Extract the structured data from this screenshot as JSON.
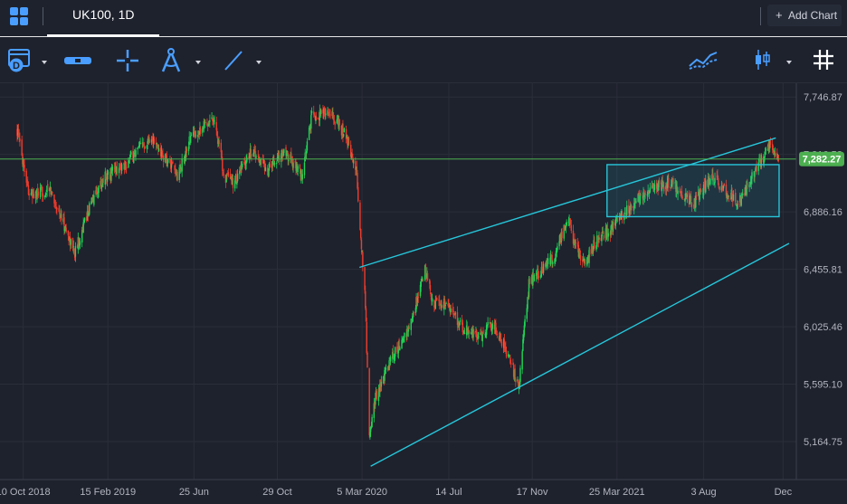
{
  "header": {
    "tab_title": "UK100, 1D",
    "add_chart_label": "Add Chart",
    "icons": [
      "layout-grid-icon",
      "date-range-icon",
      "measure-icon",
      "crosshair-icon",
      "drawing-compass-icon",
      "trend-line-icon",
      "indicators-icon",
      "candle-style-icon",
      "grid-toggle-icon"
    ]
  },
  "chart_data": {
    "type": "candlestick",
    "symbol": "UK100",
    "interval": "1D",
    "x_tick_labels": [
      "10 Oct 2018",
      "15 Feb 2019",
      "25 Jun",
      "29 Oct",
      "5 Mar 2020",
      "14 Jul",
      "17 Nov",
      "25 Mar 2021",
      "3 Aug",
      "Dec"
    ],
    "y_tick_labels": [
      "7,746.87",
      "7,316.52",
      "6,886.16",
      "6,455.81",
      "6,025.46",
      "5,595.10",
      "5,164.75"
    ],
    "ylim": [
      4880,
      7850
    ],
    "current_price": 7282.27,
    "current_price_label": "7,282.27",
    "price_path": [
      [
        "2018-10-01",
        7500
      ],
      [
        "2018-10-20",
        7000
      ],
      [
        "2018-11-20",
        7050
      ],
      [
        "2018-12-27",
        6580
      ],
      [
        "2019-01-20",
        6950
      ],
      [
        "2019-02-10",
        7150
      ],
      [
        "2019-03-15",
        7250
      ],
      [
        "2019-04-20",
        7450
      ],
      [
        "2019-05-10",
        7300
      ],
      [
        "2019-06-01",
        7150
      ],
      [
        "2019-06-20",
        7450
      ],
      [
        "2019-07-25",
        7600
      ],
      [
        "2019-08-10",
        7150
      ],
      [
        "2019-08-25",
        7100
      ],
      [
        "2019-09-20",
        7350
      ],
      [
        "2019-10-15",
        7200
      ],
      [
        "2019-11-10",
        7350
      ],
      [
        "2019-12-05",
        7150
      ],
      [
        "2019-12-20",
        7600
      ],
      [
        "2020-01-15",
        7640
      ],
      [
        "2020-02-10",
        7450
      ],
      [
        "2020-02-25",
        7200
      ],
      [
        "2020-03-10",
        6200
      ],
      [
        "2020-03-16",
        5200
      ],
      [
        "2020-03-25",
        5500
      ],
      [
        "2020-04-20",
        5800
      ],
      [
        "2020-05-15",
        6000
      ],
      [
        "2020-06-08",
        6450
      ],
      [
        "2020-06-20",
        6200
      ],
      [
        "2020-07-10",
        6200
      ],
      [
        "2020-08-05",
        6000
      ],
      [
        "2020-09-01",
        5950
      ],
      [
        "2020-09-15",
        6050
      ],
      [
        "2020-10-05",
        5900
      ],
      [
        "2020-10-28",
        5580
      ],
      [
        "2020-11-12",
        6350
      ],
      [
        "2020-12-01",
        6450
      ],
      [
        "2020-12-20",
        6550
      ],
      [
        "2021-01-10",
        6850
      ],
      [
        "2021-01-20",
        6650
      ],
      [
        "2021-02-05",
        6500
      ],
      [
        "2021-02-25",
        6700
      ],
      [
        "2021-03-15",
        6750
      ],
      [
        "2021-04-10",
        6900
      ],
      [
        "2021-05-10",
        7050
      ],
      [
        "2021-06-15",
        7100
      ],
      [
        "2021-07-20",
        6950
      ],
      [
        "2021-08-15",
        7150
      ],
      [
        "2021-09-05",
        7050
      ],
      [
        "2021-09-25",
        6960
      ],
      [
        "2021-10-20",
        7200
      ],
      [
        "2021-11-10",
        7380
      ],
      [
        "2021-11-24",
        7300
      ]
    ],
    "drawings": [
      {
        "kind": "trendline",
        "from": [
          "2020-03-01",
          6470
        ],
        "to": [
          "2021-11-20",
          7440
        ],
        "color": "#26c6da"
      },
      {
        "kind": "trendline",
        "from": [
          "2020-03-18",
          4980
        ],
        "to": [
          "2021-12-10",
          6650
        ],
        "color": "#26c6da"
      },
      {
        "kind": "rectangle",
        "from": [
          "2021-03-10",
          6850
        ],
        "to": [
          "2021-11-25",
          7240
        ],
        "color": "#26c6da"
      },
      {
        "kind": "hline",
        "price": 7282.27,
        "color": "#4caf50"
      }
    ],
    "up_color": "#26a69a",
    "down_color": "#ef5350"
  },
  "colors": {
    "background": "#1e222d",
    "grid": "#2a2e39",
    "accent": "#4a9eff",
    "price_tag": "#4caf50"
  }
}
